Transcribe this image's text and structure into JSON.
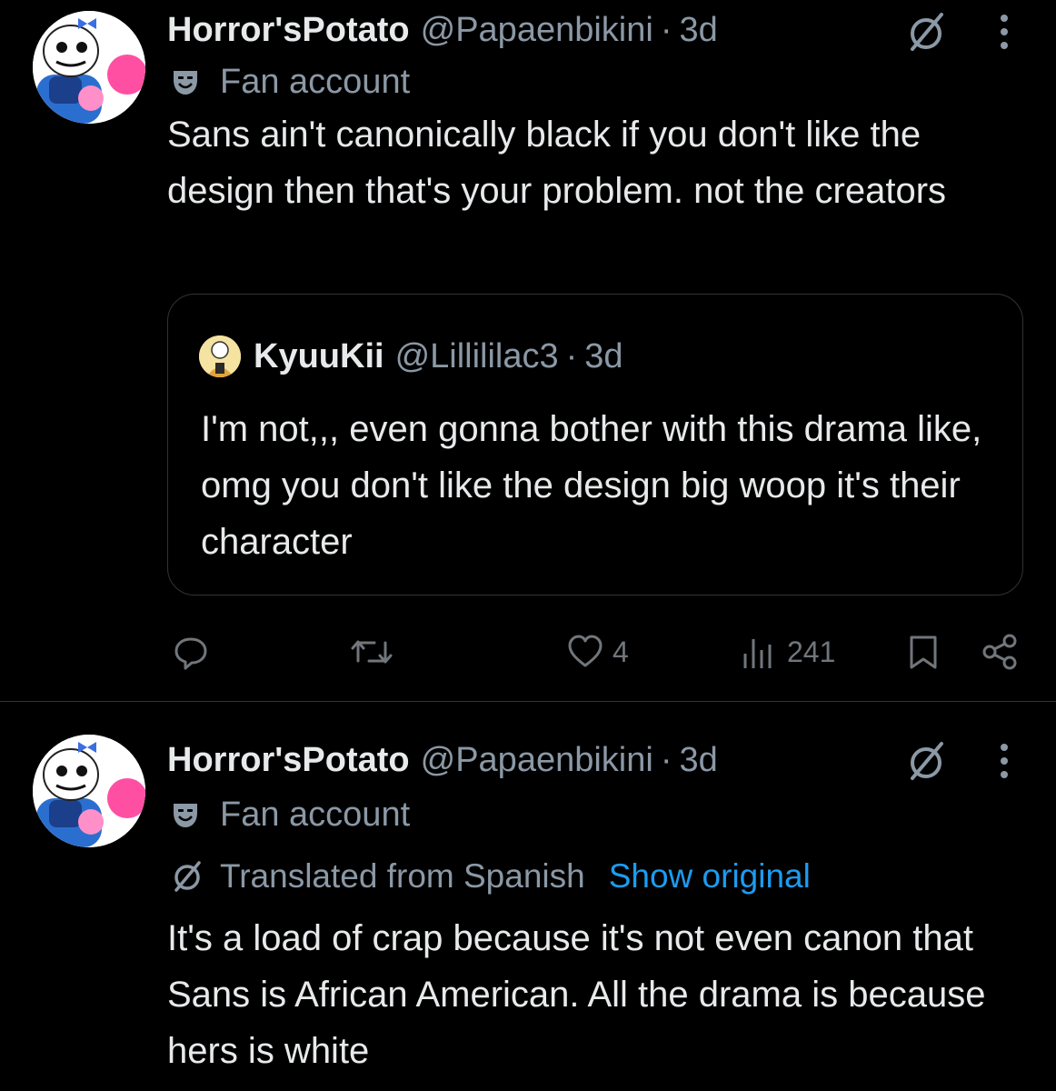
{
  "posts": [
    {
      "display_name": "Horror'sPotato",
      "handle": "@Papaenbikini",
      "separator": "·",
      "time": "3d",
      "label": "Fan account",
      "text": "Sans ain't canonically black if you don't like the design then that's your problem. not the creators",
      "quote": {
        "display_name": "KyuuKii",
        "handle": "@Lillililac3",
        "separator": "·",
        "time": "3d",
        "text": "I'm not,,, even gonna bother with this drama like, omg you don't like the design big woop it's their character"
      },
      "actions": {
        "likes": "4",
        "views": "241"
      }
    },
    {
      "display_name": "Horror'sPotato",
      "handle": "@Papaenbikini",
      "separator": "·",
      "time": "3d",
      "label": "Fan account",
      "translation_note": "Translated from Spanish",
      "show_original": "Show original",
      "text": "It's a load of crap because it's not even canon that Sans is African American. All the drama is because hers is white"
    }
  ],
  "icons": {
    "reply": "reply-icon",
    "repost": "repost-icon",
    "like": "heart-icon",
    "views": "views-icon",
    "bookmark": "bookmark-icon",
    "share": "share-icon",
    "grok": "grok-icon",
    "more": "more-icon",
    "mask": "mask-icon"
  },
  "colors": {
    "background": "#000000",
    "primary_text": "#e7e9ea",
    "secondary_text": "#8b98a5",
    "link": "#1d9bf0",
    "border": "#2f3336"
  }
}
